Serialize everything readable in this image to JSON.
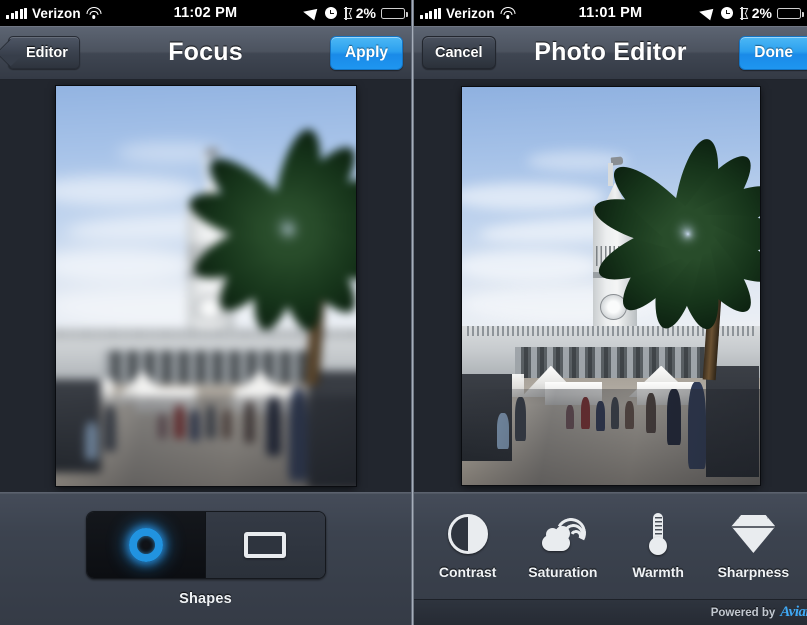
{
  "left_panel": {
    "status_bar": {
      "carrier": "Verizon",
      "signal_icon": "signal-bars-icon",
      "wifi_icon": "wifi-icon",
      "time": "11:02 PM",
      "location_icon": "location-arrow-icon",
      "alarm_icon": "alarm-clock-icon",
      "bluetooth_icon": "bluetooth-icon",
      "battery_percent": "2%",
      "battery_icon": "battery-low-icon",
      "battery_level": 12,
      "battery_color": "#d9352c"
    },
    "nav_bar": {
      "back_label": "Editor",
      "title": "Focus",
      "primary_label": "Apply",
      "primary_color": "#2ca0ef"
    },
    "toolbar": {
      "group_label": "Shapes",
      "options": [
        {
          "name": "circle",
          "icon": "circle-shape-icon",
          "selected": true,
          "glow_color": "#2193e0"
        },
        {
          "name": "rectangle",
          "icon": "rectangle-shape-icon",
          "selected": false
        }
      ]
    }
  },
  "right_panel": {
    "status_bar": {
      "carrier": "Verizon",
      "signal_icon": "signal-bars-icon",
      "wifi_icon": "wifi-icon",
      "time": "11:01 PM",
      "location_icon": "location-arrow-icon",
      "alarm_icon": "alarm-clock-icon",
      "bluetooth_icon": "bluetooth-icon",
      "battery_percent": "2%",
      "battery_icon": "battery-low-icon",
      "battery_level": 12,
      "battery_color": "#d9352c"
    },
    "nav_bar": {
      "cancel_label": "Cancel",
      "title": "Photo Editor",
      "primary_label": "Done",
      "primary_color": "#2ca0ef"
    },
    "toolbar": {
      "tools": [
        {
          "label": "Contrast",
          "icon": "contrast-icon"
        },
        {
          "label": "Saturation",
          "icon": "saturation-cloud-icon"
        },
        {
          "label": "Warmth",
          "icon": "thermometer-icon"
        },
        {
          "label": "Sharpness",
          "icon": "diamond-icon"
        }
      ],
      "powered_by_text": "Powered by",
      "powered_by_brand": "Aviary"
    }
  }
}
